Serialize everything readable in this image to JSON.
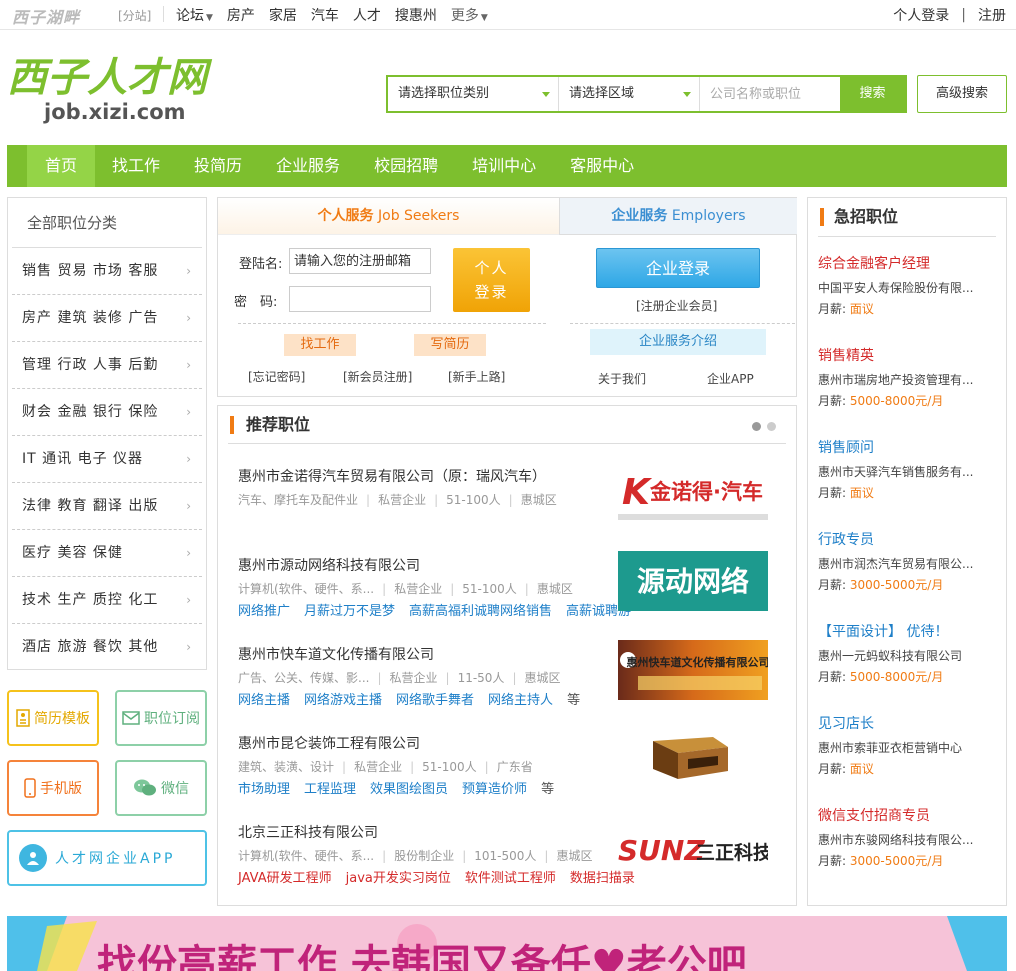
{
  "topbar": {
    "logo": "西子湖畔",
    "branch": "[分站]",
    "links": [
      "论坛",
      "房产",
      "家居",
      "汽车",
      "人才",
      "搜惠州",
      "更多"
    ],
    "login": "个人登录",
    "register": "注册"
  },
  "brand": {
    "cn": "西子人才网",
    "en": "job.xizi.com"
  },
  "search": {
    "category": "请选择职位类别",
    "region": "请选择区域",
    "placeholder": "公司名称或职位",
    "button": "搜索",
    "advanced": "高级搜索"
  },
  "nav": [
    "首页",
    "找工作",
    "投简历",
    "企业服务",
    "校园招聘",
    "培训中心",
    "客服中心"
  ],
  "categories": {
    "title": "全部职位分类",
    "rows": [
      "销售 贸易 市场 客服",
      "房产 建筑 装修 广告",
      "管理 行政 人事 后勤",
      "财会 金融 银行 保险",
      "IT 通讯 电子 仪器",
      "法律 教育 翻译 出版",
      "医疗 美容 保健",
      "技术 生产 质控 化工",
      "酒店 旅游 餐饮 其他"
    ]
  },
  "quick": {
    "resume": "简历模板",
    "subscribe": "职位订阅",
    "mobile": "手机版",
    "wechat": "微信",
    "app": "人才网企业APP"
  },
  "login": {
    "personal_bold": "个人服务",
    "personal_en": "Job Seekers",
    "enterprise_bold": "企业服务",
    "enterprise_en": "Employers",
    "user_label": "登陆名:",
    "user_placeholder": "请输入您的注册邮箱",
    "pass_label": "密　码:",
    "login_btn_1": "个人",
    "login_btn_2": "登录",
    "find_job": "找工作",
    "write_resume": "写简历",
    "forgot": "[忘记密码]",
    "new_reg": "[新会员注册]",
    "newbie": "[新手上路]",
    "enterprise_login": "企业登录",
    "enterprise_reg": "[注册企业会员]",
    "enterprise_intro": "企业服务介绍",
    "about": "关于我们",
    "app": "企业APP"
  },
  "recommended": {
    "title": "推荐职位",
    "companies": [
      {
        "name": "惠州市金诺得汽车贸易有限公司（原：瑞风汽车）",
        "industry": "汽车、摩托车及配件业",
        "type": "私营企业",
        "size": "51-100人",
        "area": "惠城区",
        "jobs": [],
        "logo": "金诺得·汽车"
      },
      {
        "name": "惠州市源动网络科技有限公司",
        "industry": "计算机(软件、硬件、系...",
        "type": "私营企业",
        "size": "51-100人",
        "area": "惠城区",
        "jobs": [
          "网络推广",
          "月薪过万不是梦",
          "高薪高福利诚聘网络销售",
          "高薪诚聘游"
        ],
        "logo": "源动网络"
      },
      {
        "name": "惠州市快车道文化传播有限公司",
        "industry": "广告、公关、传媒、影...",
        "type": "私营企业",
        "size": "11-50人",
        "area": "惠城区",
        "jobs": [
          "网络主播",
          "网络游戏主播",
          "网络歌手舞者",
          "网络主持人"
        ],
        "more": "等",
        "logo": "惠州快车道文化传播有限公司"
      },
      {
        "name": "惠州市昆仑装饰工程有限公司",
        "industry": "建筑、装潢、设计",
        "type": "私营企业",
        "size": "51-100人",
        "area": "广东省",
        "jobs": [
          "市场助理",
          "工程监理",
          "效果图绘图员",
          "预算造价师"
        ],
        "more": "等",
        "logo": ""
      },
      {
        "name": "北京三正科技有限公司",
        "industry": "计算机(软件、硬件、系...",
        "type": "股份制企业",
        "size": "101-500人",
        "area": "惠城区",
        "jobs": [
          "JAVA研发工程师",
          "java开发实习岗位",
          "软件测试工程师",
          "数据扫描录"
        ],
        "logo_en": "SUNZ",
        "logo": "三正科技"
      }
    ]
  },
  "urgent": {
    "title": "急招职位",
    "salary_label": "月薪:",
    "items": [
      {
        "title": "综合金融客户经理",
        "color": "#d42a2a",
        "company": "中国平安人寿保险股份有限...",
        "salary": "面议"
      },
      {
        "title": "销售精英",
        "color": "#d42a2a",
        "company": "惠州市瑞房地产投资管理有...",
        "salary": "5000-8000元/月"
      },
      {
        "title": "销售顾问",
        "color": "#1e7fc8",
        "company": "惠州市天驿汽车销售服务有...",
        "salary": "面议"
      },
      {
        "title": "行政专员",
        "color": "#1e7fc8",
        "company": "惠州市润杰汽车贸易有限公...",
        "salary": "3000-5000元/月"
      },
      {
        "title": "【平面设计】 优待！",
        "color": "#1e7fc8",
        "company": "惠州一元蚂蚁科技有限公司",
        "salary": "5000-8000元/月"
      },
      {
        "title": "见习店长",
        "color": "#1e7fc8",
        "company": "惠州市索菲亚衣柜营销中心",
        "salary": "面议"
      },
      {
        "title": "微信支付招商专员",
        "color": "#d42a2a",
        "company": "惠州市东骏网络科技有限公...",
        "salary": "3000-5000元/月"
      }
    ]
  },
  "banner": {
    "text": "找份高薪工作 去韩国又备任♥老公吧"
  }
}
